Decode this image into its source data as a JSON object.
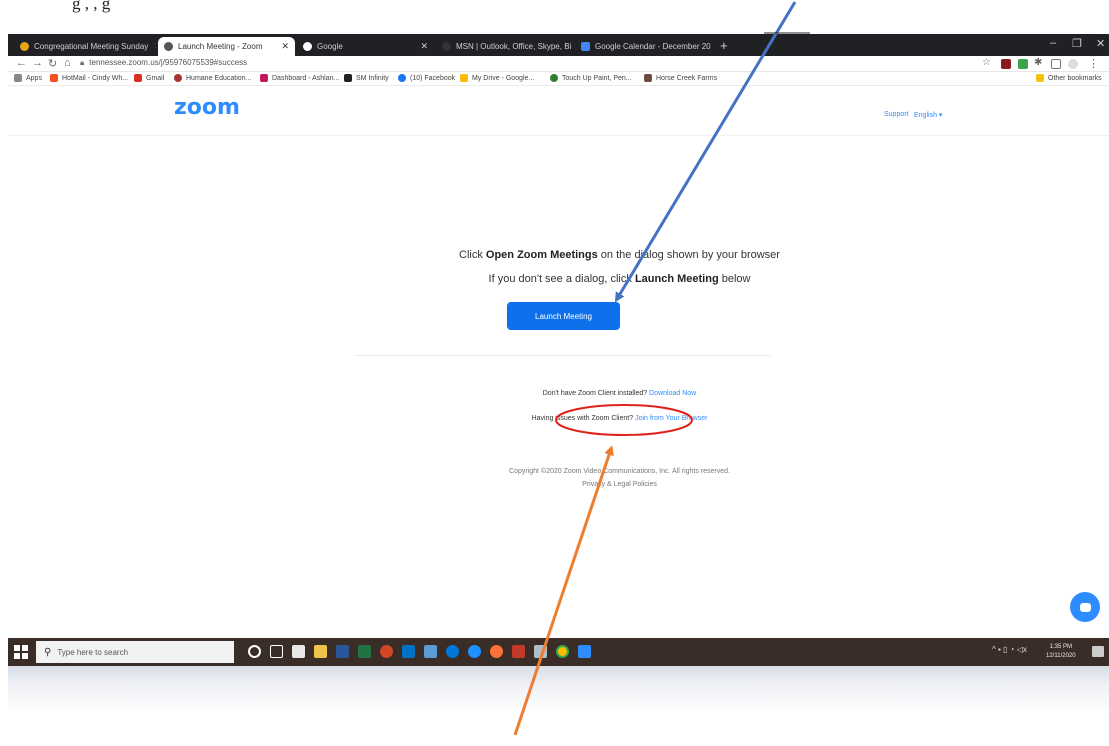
{
  "document": {
    "caption_fragment": "g        ,                    ,                                                          g            "
  },
  "browser": {
    "tabs": [
      {
        "label": "Congregational Meeting Sunday",
        "active": false
      },
      {
        "label": "Launch Meeting - Zoom",
        "active": true
      },
      {
        "label": "Google",
        "active": false
      },
      {
        "label": "MSN | Outlook, Office, Skype, Bi",
        "active": false
      },
      {
        "label": "Google Calendar - December 20",
        "active": false
      }
    ],
    "url": "tennessee.zoom.us/j/95976075539#success",
    "bookmarks": [
      "Apps",
      "HotMail - Cindy Wh...",
      "Gmail",
      "Humane Education...",
      "Dashboard - Ashlan...",
      "SM Infinity",
      "(10) Facebook",
      "My Drive - Google...",
      "Touch Up Paint, Pen...",
      "Horse Creek Farms"
    ],
    "other_bookmarks": "Other bookmarks"
  },
  "zoom_page": {
    "logo": "zoom",
    "support": "Support",
    "language": "English ▾",
    "line1_pre": "Click ",
    "line1_bold": "Open Zoom Meetings",
    "line1_post": " on the dialog shown by your browser",
    "line2_pre": "If you don't see a dialog, click ",
    "line2_bold": "Launch Meeting",
    "line2_post": " below",
    "launch_button": "Launch Meeting",
    "download_pre": "Don't have Zoom Client installed? ",
    "download_link": "Download Now",
    "issues_pre": "Having issues with Zoom Client? ",
    "issues_link": "Join from Your Browser",
    "copyright": "Copyright ©2020 Zoom Video Communications, Inc. All rights reserved.",
    "privacy": "Privacy & Legal Policies"
  },
  "taskbar": {
    "search_placeholder": "Type here to search",
    "time": "1:35 PM",
    "date": "12/11/2020"
  },
  "colors": {
    "zoom_blue": "#2d8cff",
    "button_blue": "#0e71eb",
    "arrow_blue": "#4472c4",
    "arrow_orange": "#ed7d31",
    "circle_red": "#e0201a"
  }
}
